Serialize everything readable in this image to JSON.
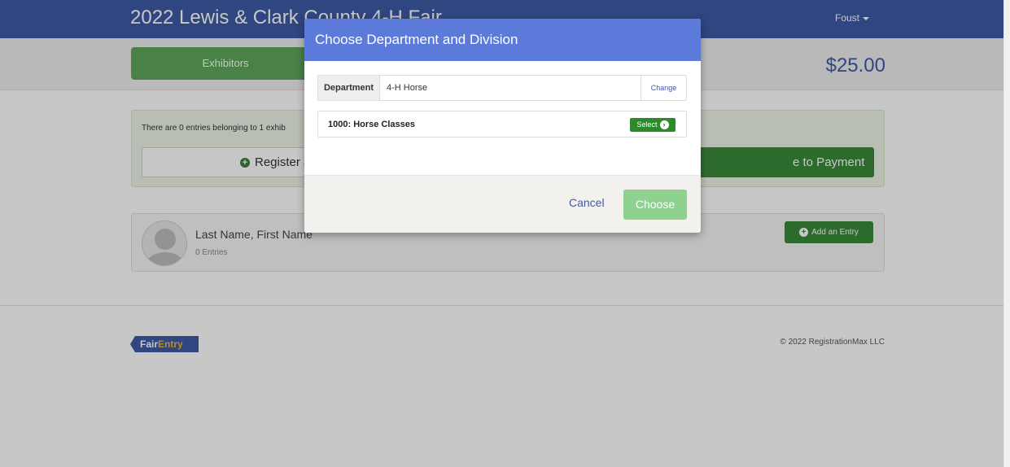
{
  "navbar": {
    "brand": "2022 Lewis & Clark County 4-H Fair",
    "user": "Foust"
  },
  "subbar": {
    "exhibitors_tab": "Exhibitors",
    "total": "$25.00"
  },
  "summary": {
    "text": "There are 0 entries belonging to 1 exhib",
    "register_label": "Register a",
    "payment_label": "e to Payment"
  },
  "exhibitor": {
    "name": "Last Name, First Name",
    "entries": "0 Entries",
    "add_entry_label": "Add an Entry"
  },
  "footer": {
    "logo_part1": "Fair",
    "logo_part2": "Entry",
    "copyright": "© 2022 RegistrationMax LLC"
  },
  "modal": {
    "title": "Choose Department and Division",
    "department_label": "Department",
    "department_value": "4-H Horse",
    "change_label": "Change",
    "division_label": "1000: Horse Classes",
    "select_label": "Select",
    "cancel_label": "Cancel",
    "choose_label": "Choose"
  },
  "colors": {
    "brand": "#3e5aa6",
    "modal_header": "#5b7ad9",
    "success": "#3a8a3a",
    "choose_disabled": "#8fd18f"
  }
}
